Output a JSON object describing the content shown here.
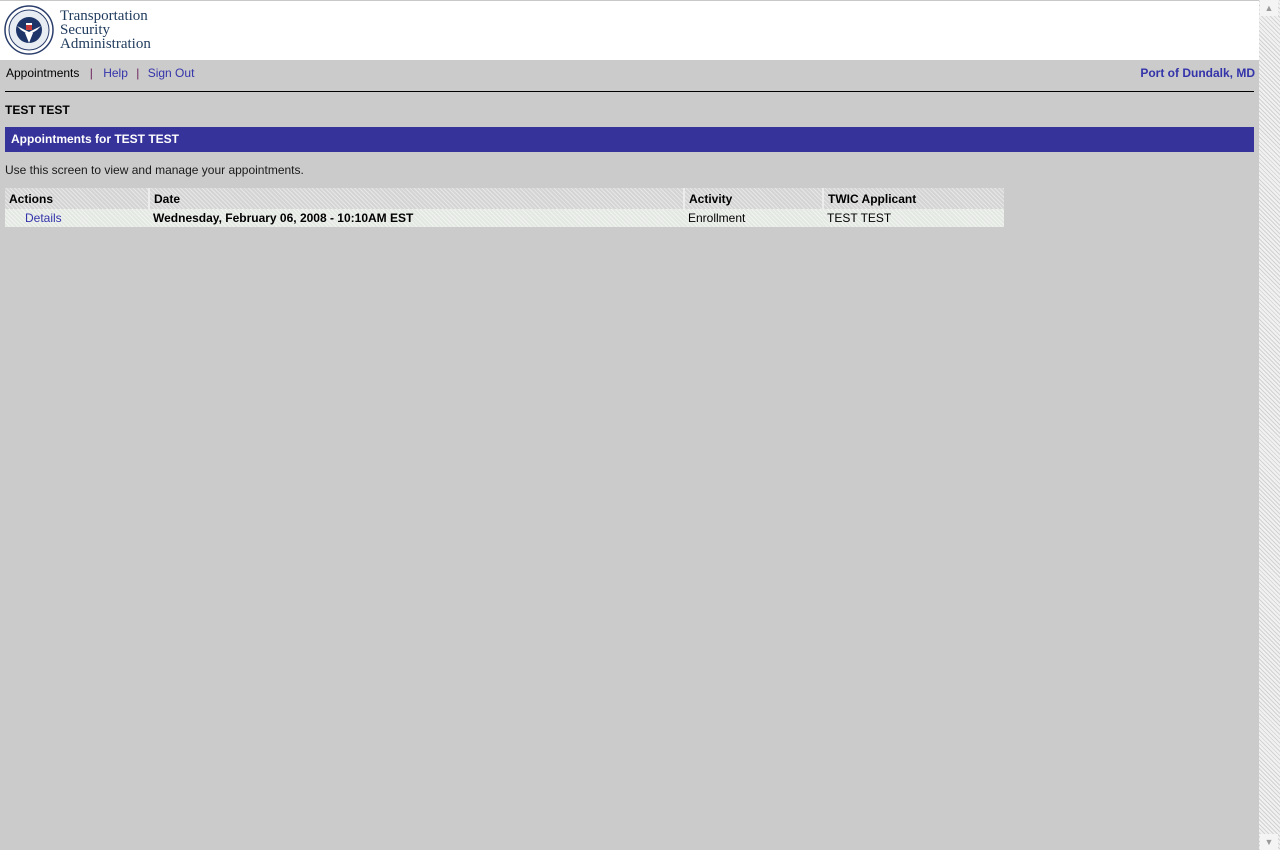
{
  "header": {
    "logo": {
      "line1": "Transportation",
      "line2": "Security",
      "line3": "Administration",
      "icon": "dhs-seal-icon"
    }
  },
  "nav": {
    "current": "Appointments",
    "separator": "|",
    "links": [
      {
        "label": "Help"
      },
      {
        "label": "Sign Out"
      }
    ],
    "location": "Port of Dundalk, MD"
  },
  "user": {
    "name": "TEST TEST"
  },
  "section": {
    "title": "Appointments for TEST TEST",
    "instructions": "Use this screen to view and manage your appointments."
  },
  "table": {
    "columns": [
      "Actions",
      "Date",
      "Activity",
      "TWIC Applicant"
    ],
    "rows": [
      {
        "action": "Details",
        "date": "Wednesday, February 06, 2008 - 10:10AM EST",
        "activity": "Enrollment",
        "applicant": "TEST TEST"
      }
    ]
  },
  "scrollbar": {
    "up_icon": "arrow-up-icon",
    "down_icon": "arrow-down-icon"
  },
  "colors": {
    "page_bg": "#cbcbcb",
    "section_bar": "#36339a",
    "link": "#3333aa"
  }
}
